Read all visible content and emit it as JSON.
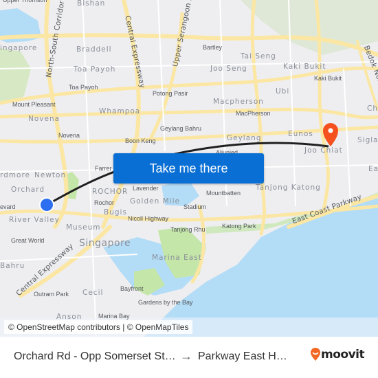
{
  "map": {
    "labels": {
      "upper_thomson": "Upper Thomson",
      "bishan": "Bishan",
      "singapore_nw": "ingapore",
      "north_south_corridor": "North-South Corridor",
      "braddell": "Braddell",
      "toa_payoh_area": "Toa Payoh",
      "toa_payoh_stn": "Toa Payoh",
      "central_expressway_n": "Central Expressway",
      "upper_serangoon": "Upper Serangoon Road",
      "potong_pasir": "Potong Pasir",
      "mount_pleasant": "Mount Pleasant",
      "whampoa": "Whampoa",
      "novena_area": "Novena",
      "novena_stn": "Novena",
      "bartley": "Bartley",
      "tai_seng": "Tai Seng",
      "joo_seng": "Joo Seng",
      "kaki_bukit_area": "Kaki Bukit",
      "kaki_bukit_stn": "Kaki Bukit",
      "ubi": "Ubi",
      "macpherson_area": "Macpherson",
      "macpherson_stn": "MacPherson",
      "bedok_north": "Bedok North",
      "chai": "Cha",
      "geylang_bahru": "Geylang Bahru",
      "boon_keng": "Boon Keng",
      "geylang": "Geylang",
      "eunos": "Eunos",
      "siglap": "Siglap",
      "joo_chiat": "Joo Chiat",
      "aljunied": "Aljunied",
      "ardmore": "rdmore",
      "newton": "Newton",
      "farrer": "Farrer",
      "orchard": "Orchard",
      "boulevard": "evard",
      "river_valley": "River Valley",
      "rochor_area": "ROCHOR",
      "rochor_stn": "Rochor",
      "lavender": "Lavender",
      "golden_mile": "Golden Mile",
      "stadium": "Stadium",
      "mountbatten": "Mountbatten",
      "tanjong_katong": "Tanjong Katong",
      "east_area": "Ea",
      "bugis": "Bugis",
      "nicoll_highway": "Nicoll Highway",
      "museum": "Museum",
      "singapore": "Singapore",
      "great_world": "Great World",
      "tanjong_rhu": "Tanjong Rhu",
      "katong_park": "Katong Park",
      "east_coast_parkway": "East Coast Parkway",
      "bahru": "Bahru",
      "central_expressway_s": "Central Expressway",
      "marina_east": "Marina East",
      "outram_park": "Outram Park",
      "cecil": "Cecil",
      "bayfront": "Bayfront",
      "gardens_by_the_bay": "Gardens by the Bay",
      "anson": "Anson",
      "marina_bay": "Marina Bay"
    },
    "origin_marker": {
      "name": "origin-marker",
      "color": "#2e6ff2"
    },
    "destination_marker": {
      "name": "destination-pin",
      "color": "#f4511e"
    },
    "route_color": "#1f1f1f",
    "cta_label": "Take me there",
    "cta_color": "#0a6fd4",
    "attribution": "© OpenStreetMap contributors | © OpenMapTiles"
  },
  "footer": {
    "from": "Orchard Rd - Opp Somerset St…",
    "arrow": "→",
    "to": "Parkway East H…",
    "brand": "moovit",
    "brand_color": "#f26722"
  }
}
